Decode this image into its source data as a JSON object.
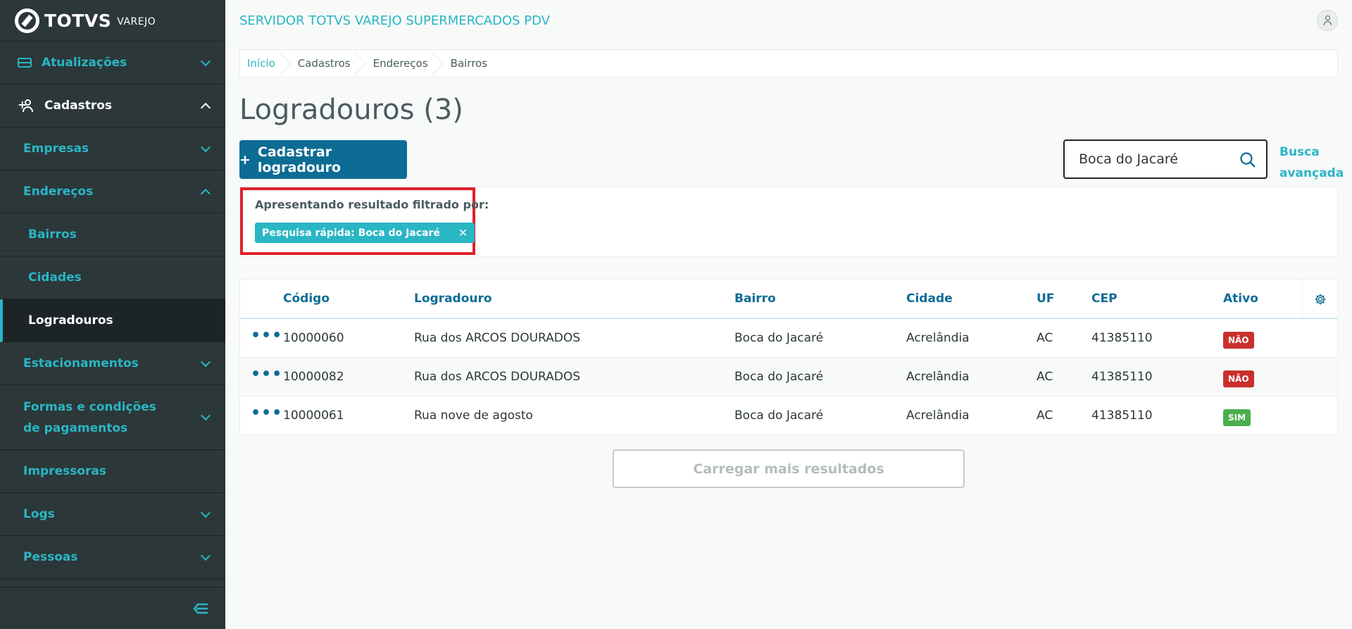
{
  "brand": {
    "name": "TOTVS",
    "sub": "VAREJO"
  },
  "sidebar": {
    "items": [
      {
        "label": "Atualizações"
      },
      {
        "label": "Cadastros"
      },
      {
        "label": "Empresas"
      },
      {
        "label": "Endereços"
      },
      {
        "label": "Bairros"
      },
      {
        "label": "Cidades"
      },
      {
        "label": "Logradouros"
      },
      {
        "label": "Estacionamentos"
      },
      {
        "label": "Formas e condições de pagamentos"
      },
      {
        "label": "Impressoras"
      },
      {
        "label": "Logs"
      },
      {
        "label": "Pessoas"
      }
    ]
  },
  "header": {
    "title": "SERVIDOR TOTVS VAREJO SUPERMERCADOS PDV"
  },
  "breadcrumb": [
    "Início",
    "Cadastros",
    "Endereços",
    "Bairros"
  ],
  "page": {
    "title": "Logradouros (3)",
    "add_label": "Cadastrar logradouro",
    "add_symbol": "+"
  },
  "search": {
    "value": "Boca do Jacaré",
    "advanced_line1": "Busca",
    "advanced_line2": "avançada"
  },
  "filter": {
    "label": "Apresentando resultado filtrado por:",
    "chip": "Pesquisa rápida: Boca do Jacaré",
    "chip_close": "✕"
  },
  "table": {
    "columns": [
      "Código",
      "Logradouro",
      "Bairro",
      "Cidade",
      "UF",
      "CEP",
      "Ativo"
    ],
    "rows": [
      {
        "codigo": "10000060",
        "logradouro": "Rua dos ARCOS DOURADOS",
        "bairro": "Boca do Jacaré",
        "cidade": "Acrelândia",
        "uf": "AC",
        "cep": "41385110",
        "ativo": "NÃO"
      },
      {
        "codigo": "10000082",
        "logradouro": "Rua dos ARCOS DOURADOS",
        "bairro": "Boca do Jacaré",
        "cidade": "Acrelândia",
        "uf": "AC",
        "cep": "41385110",
        "ativo": "NÃO"
      },
      {
        "codigo": "10000061",
        "logradouro": "Rua nove de agosto",
        "bairro": "Boca do Jacaré",
        "cidade": "Acrelândia",
        "uf": "AC",
        "cep": "41385110",
        "ativo": "SIM"
      }
    ],
    "row_actions": "•••"
  },
  "load_more": "Carregar mais resultados",
  "colors": {
    "accent": "#29b6c5",
    "primary": "#0c6c94",
    "sidebar": "#2c3739",
    "danger": "#c9302c",
    "success": "#4cae4c",
    "highlight": "#e01f2c"
  },
  "icons": [
    "database-icon",
    "user-add-icon",
    "chevron-down-icon",
    "chevron-up-icon",
    "collapse-menu-icon",
    "user-avatar-icon",
    "search-icon",
    "close-icon",
    "settings-gear-icon",
    "more-actions-icon"
  ]
}
